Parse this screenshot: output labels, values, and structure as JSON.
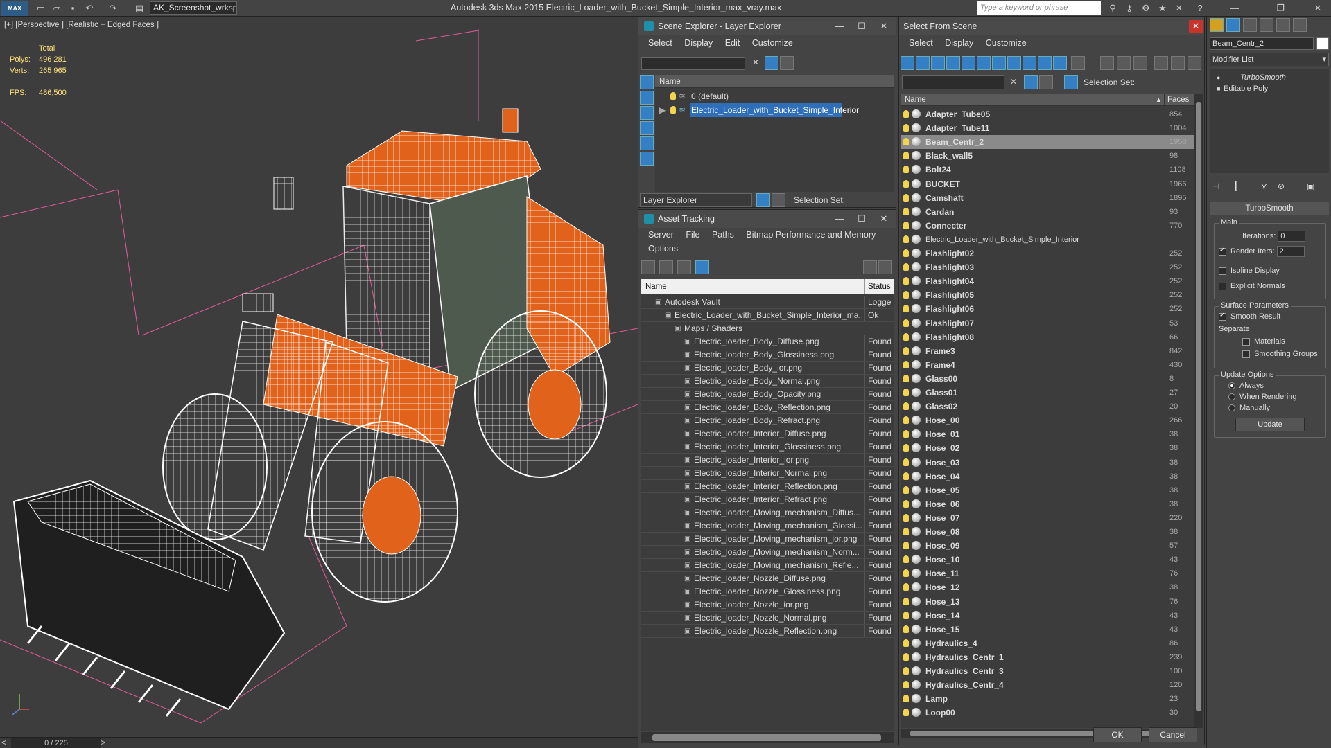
{
  "app": {
    "logo": "MAX",
    "workspace": "AK_Screenshot_wrksp",
    "title": "Autodesk 3ds Max  2015    Electric_Loader_with_Bucket_Simple_Interior_max_vray.max",
    "search_placeholder": "Type a keyword or phrase"
  },
  "viewport": {
    "label": "[+] [Perspective ] [Realistic + Edged Faces ]",
    "stats_title": "Total",
    "polys_label": "Polys:",
    "polys": "496 281",
    "verts_label": "Verts:",
    "verts": "265 965",
    "fps_label": "FPS:",
    "fps": "486,500"
  },
  "status": {
    "frame": "0 / 225"
  },
  "scene_explorer": {
    "title": "Scene Explorer - Layer Explorer",
    "menu": [
      "Select",
      "Display",
      "Edit",
      "Customize"
    ],
    "col_name": "Name",
    "rows": [
      "0 (default)",
      "Electric_Loader_with_Bucket_Simple_Interior"
    ],
    "footer_dropdown": "Layer Explorer",
    "selection_set": "Selection Set:"
  },
  "asset_tracking": {
    "title": "Asset Tracking",
    "menu": [
      "Server",
      "File",
      "Paths",
      "Bitmap Performance and Memory"
    ],
    "menu2": "Options",
    "col_name": "Name",
    "col_status": "Status",
    "rows": [
      {
        "name": "Autodesk Vault",
        "status": "Logge",
        "indent": 1
      },
      {
        "name": "Electric_Loader_with_Bucket_Simple_Interior_ma...",
        "status": "Ok",
        "indent": 2
      },
      {
        "name": "Maps / Shaders",
        "status": "",
        "indent": 3
      },
      {
        "name": "Electric_loader_Body_Diffuse.png",
        "status": "Found",
        "indent": 4
      },
      {
        "name": "Electric_loader_Body_Glossiness.png",
        "status": "Found",
        "indent": 4
      },
      {
        "name": "Electric_loader_Body_ior.png",
        "status": "Found",
        "indent": 4
      },
      {
        "name": "Electric_loader_Body_Normal.png",
        "status": "Found",
        "indent": 4
      },
      {
        "name": "Electric_loader_Body_Opacity.png",
        "status": "Found",
        "indent": 4
      },
      {
        "name": "Electric_loader_Body_Reflection.png",
        "status": "Found",
        "indent": 4
      },
      {
        "name": "Electric_loader_Body_Refract.png",
        "status": "Found",
        "indent": 4
      },
      {
        "name": "Electric_loader_Interior_Diffuse.png",
        "status": "Found",
        "indent": 4
      },
      {
        "name": "Electric_loader_Interior_Glossiness.png",
        "status": "Found",
        "indent": 4
      },
      {
        "name": "Electric_loader_Interior_ior.png",
        "status": "Found",
        "indent": 4
      },
      {
        "name": "Electric_loader_Interior_Normal.png",
        "status": "Found",
        "indent": 4
      },
      {
        "name": "Electric_loader_Interior_Reflection.png",
        "status": "Found",
        "indent": 4
      },
      {
        "name": "Electric_loader_Interior_Refract.png",
        "status": "Found",
        "indent": 4
      },
      {
        "name": "Electric_loader_Moving_mechanism_Diffus...",
        "status": "Found",
        "indent": 4
      },
      {
        "name": "Electric_loader_Moving_mechanism_Glossi...",
        "status": "Found",
        "indent": 4
      },
      {
        "name": "Electric_loader_Moving_mechanism_ior.png",
        "status": "Found",
        "indent": 4
      },
      {
        "name": "Electric_loader_Moving_mechanism_Norm...",
        "status": "Found",
        "indent": 4
      },
      {
        "name": "Electric_loader_Moving_mechanism_Refle...",
        "status": "Found",
        "indent": 4
      },
      {
        "name": "Electric_loader_Nozzle_Diffuse.png",
        "status": "Found",
        "indent": 4
      },
      {
        "name": "Electric_loader_Nozzle_Glossiness.png",
        "status": "Found",
        "indent": 4
      },
      {
        "name": "Electric_loader_Nozzle_ior.png",
        "status": "Found",
        "indent": 4
      },
      {
        "name": "Electric_loader_Nozzle_Normal.png",
        "status": "Found",
        "indent": 4
      },
      {
        "name": "Electric_loader_Nozzle_Reflection.png",
        "status": "Found",
        "indent": 4
      }
    ]
  },
  "select_from_scene": {
    "title": "Select From Scene",
    "menu": [
      "Select",
      "Display",
      "Customize"
    ],
    "selection_set": "Selection Set:",
    "col_name": "Name",
    "col_faces": "Faces",
    "ok": "OK",
    "cancel": "Cancel",
    "rows": [
      {
        "name": "Adapter_Tube05",
        "faces": "854"
      },
      {
        "name": "Adapter_Tube11",
        "faces": "1004"
      },
      {
        "name": "Beam_Centr_2",
        "faces": "1958",
        "selected": true
      },
      {
        "name": "Black_wall5",
        "faces": "98"
      },
      {
        "name": "Bolt24",
        "faces": "1108"
      },
      {
        "name": "BUCKET",
        "faces": "1966"
      },
      {
        "name": "Camshaft",
        "faces": "1895"
      },
      {
        "name": "Cardan",
        "faces": "93"
      },
      {
        "name": "Connecter",
        "faces": "770"
      },
      {
        "name": "Electric_Loader_with_Bucket_Simple_Interior",
        "faces": "",
        "layer": true
      },
      {
        "name": "Flashlight02",
        "faces": "252"
      },
      {
        "name": "Flashlight03",
        "faces": "252"
      },
      {
        "name": "Flashlight04",
        "faces": "252"
      },
      {
        "name": "Flashlight05",
        "faces": "252"
      },
      {
        "name": "Flashlight06",
        "faces": "252"
      },
      {
        "name": "Flashlight07",
        "faces": "53"
      },
      {
        "name": "Flashlight08",
        "faces": "66"
      },
      {
        "name": "Frame3",
        "faces": "842"
      },
      {
        "name": "Frame4",
        "faces": "430"
      },
      {
        "name": "Glass00",
        "faces": "8"
      },
      {
        "name": "Glass01",
        "faces": "27"
      },
      {
        "name": "Glass02",
        "faces": "20"
      },
      {
        "name": "Hose_00",
        "faces": "266"
      },
      {
        "name": "Hose_01",
        "faces": "38"
      },
      {
        "name": "Hose_02",
        "faces": "38"
      },
      {
        "name": "Hose_03",
        "faces": "38"
      },
      {
        "name": "Hose_04",
        "faces": "38"
      },
      {
        "name": "Hose_05",
        "faces": "38"
      },
      {
        "name": "Hose_06",
        "faces": "38"
      },
      {
        "name": "Hose_07",
        "faces": "220"
      },
      {
        "name": "Hose_08",
        "faces": "38"
      },
      {
        "name": "Hose_09",
        "faces": "57"
      },
      {
        "name": "Hose_10",
        "faces": "43"
      },
      {
        "name": "Hose_11",
        "faces": "76"
      },
      {
        "name": "Hose_12",
        "faces": "38"
      },
      {
        "name": "Hose_13",
        "faces": "76"
      },
      {
        "name": "Hose_14",
        "faces": "43"
      },
      {
        "name": "Hose_15",
        "faces": "43"
      },
      {
        "name": "Hydraulics_4",
        "faces": "86"
      },
      {
        "name": "Hydraulics_Centr_1",
        "faces": "239"
      },
      {
        "name": "Hydraulics_Centr_3",
        "faces": "100"
      },
      {
        "name": "Hydraulics_Centr_4",
        "faces": "120"
      },
      {
        "name": "Lamp",
        "faces": "23"
      },
      {
        "name": "Loop00",
        "faces": "30"
      }
    ]
  },
  "modifier": {
    "object_name": "Beam_Centr_2",
    "modifier_list": "Modifier List",
    "stack": [
      "TurboSmooth",
      "Editable Poly"
    ],
    "rollout": "TurboSmooth",
    "main": "Main",
    "iterations_label": "Iterations:",
    "iterations": "0",
    "render_iters_label": "Render Iters:",
    "render_iters": "2",
    "isoline": "Isoline Display",
    "explicit_normals": "Explicit Normals",
    "surface": "Surface Parameters",
    "smooth_result": "Smooth Result",
    "separate": "Separate",
    "materials": "Materials",
    "smoothing_groups": "Smoothing Groups",
    "update_options": "Update Options",
    "always": "Always",
    "when_rendering": "When Rendering",
    "manually": "Manually",
    "update": "Update"
  },
  "colors": {
    "accent": "#2f6fba",
    "orange": "#e0621b",
    "wire": "#f2f2f2",
    "stats": "#ffe27a"
  }
}
